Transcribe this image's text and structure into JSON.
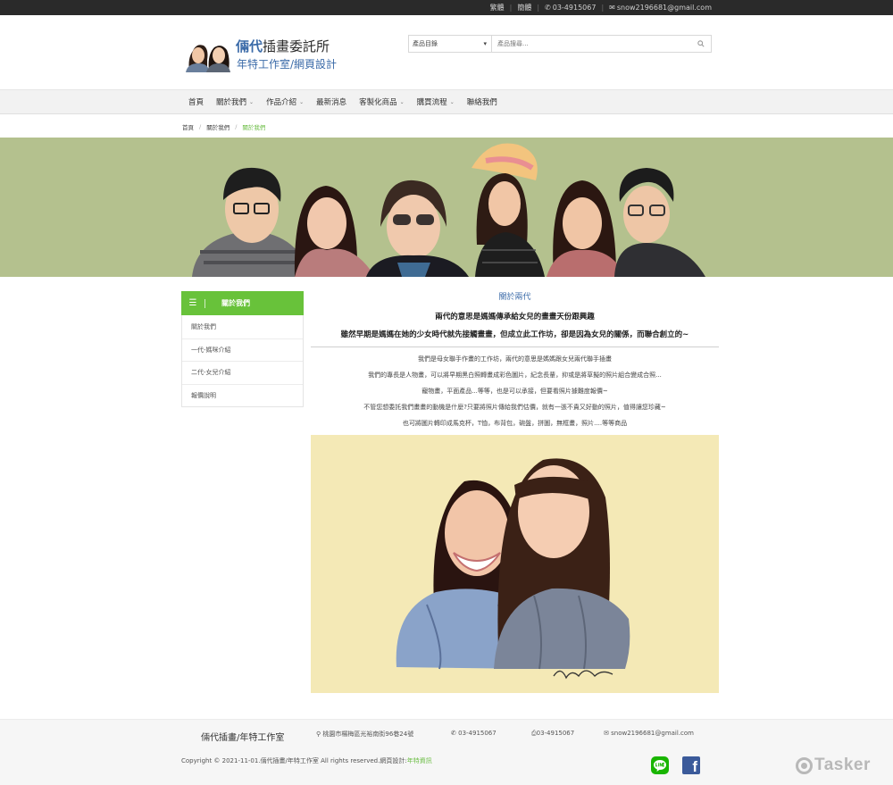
{
  "topbar": {
    "lang_trad": "繁體",
    "lang_simp": "簡體",
    "phone": "03-4915067",
    "email": "snow2196681@gmail.com"
  },
  "logo": {
    "title_highlight": "倆代",
    "title_rest": "插畫委託所",
    "subtitle": "年特工作室/網頁設計"
  },
  "search": {
    "category_label": "產品目錄",
    "placeholder": "產品搜尋..."
  },
  "nav": {
    "items": [
      {
        "label": "首頁",
        "has_dropdown": false
      },
      {
        "label": "關於我們",
        "has_dropdown": true
      },
      {
        "label": "作品介紹",
        "has_dropdown": true
      },
      {
        "label": "最新消息",
        "has_dropdown": false
      },
      {
        "label": "客製化商品",
        "has_dropdown": true
      },
      {
        "label": "購買流程",
        "has_dropdown": true
      },
      {
        "label": "聯絡我們",
        "has_dropdown": false
      }
    ]
  },
  "breadcrumb": [
    "首頁",
    "關於我們",
    "關於我們"
  ],
  "sidebar": {
    "heading": "關於我們",
    "items": [
      "關於我們",
      "一代-媽咪介紹",
      "二代-女兒介紹",
      "報價說明"
    ]
  },
  "content": {
    "title": "關於兩代",
    "heading1": "兩代的意思是媽媽傳承給女兒的畫畫天份跟興趣",
    "heading2": "雖然早期是媽媽在她的少女時代就先接觸畫畫，但成立此工作坊，卻是因為女兒的關係，而聯合創立的~",
    "paragraphs": [
      "我們是母女聯手作畫的工作坊，兩代的意思是媽媽跟女兒兩代聯手插畫",
      "我們的專長是人物畫，可以將早期黑白照轉畫成彩色圖片，紀念長輩，抑或是將草擬的照片組合變成合照...",
      "寵物畫，平面產品...等等，也是可以承接，但要看照片據難度報價~",
      "不管您想委託我們畫畫的動機是什麼?只要將照片傳給我們估價，就有一張不貴又好動的照片，值得讓您珍藏~",
      "也可將圖片轉印成馬克杯，T恤，布背包，碗盤，拼圖，無框畫，照片....等等商品"
    ]
  },
  "footer": {
    "name": "倆代插畫/年特工作室",
    "address": "桃園市楊梅區光裕南街96巷24號",
    "phone": "03-4915067",
    "fax": "03-4915067",
    "email": "snow2196681@gmail.com",
    "copyright": "Copyright © 2021-11-01.倆代插畫/年特工作室 All rights reserved.網頁設計:",
    "designer_link": "年特資訊",
    "fb_letter": "f",
    "watermark": "Tasker"
  },
  "colors": {
    "accent_green": "#68c23a",
    "brand_blue": "#3a6aa8",
    "banner_bg": "#b4c18e",
    "portrait_bg": "#f4e9b6"
  }
}
